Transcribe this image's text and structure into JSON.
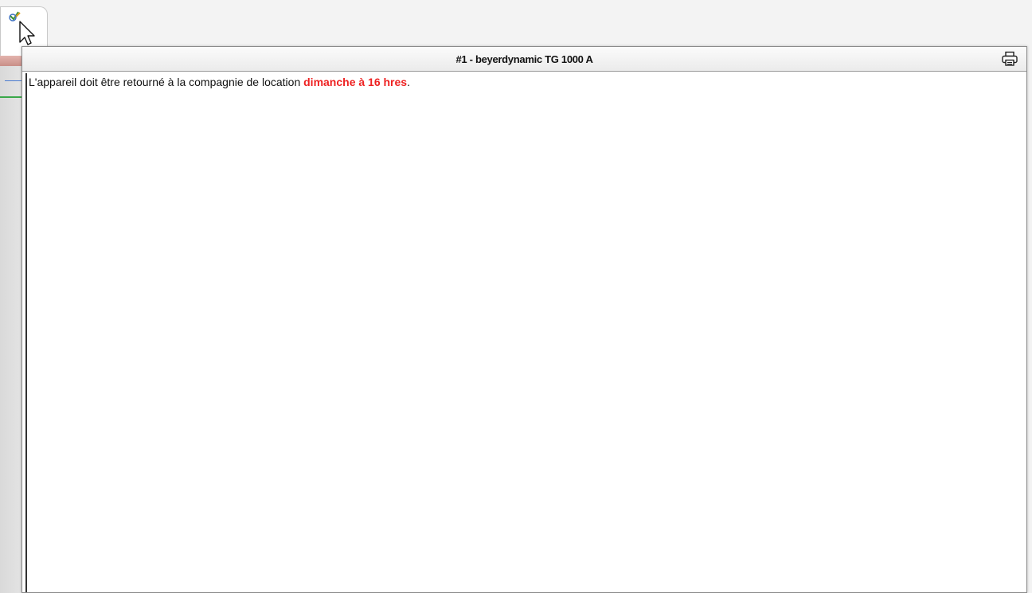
{
  "tab": {
    "icon": "checkmark-pencil-icon",
    "cursor": "mouse-pointer-icon"
  },
  "dialog": {
    "title": "#1 - beyerdynamic TG 1000 A",
    "print_icon": "printer-icon",
    "message": {
      "prefix": "L'appareil doit être retourné à la compagnie de location ",
      "emphasis": "dimanche à 16 hres",
      "suffix": "."
    }
  },
  "colors": {
    "emphasis": "#ee2222",
    "background": "#f3f3f3"
  }
}
